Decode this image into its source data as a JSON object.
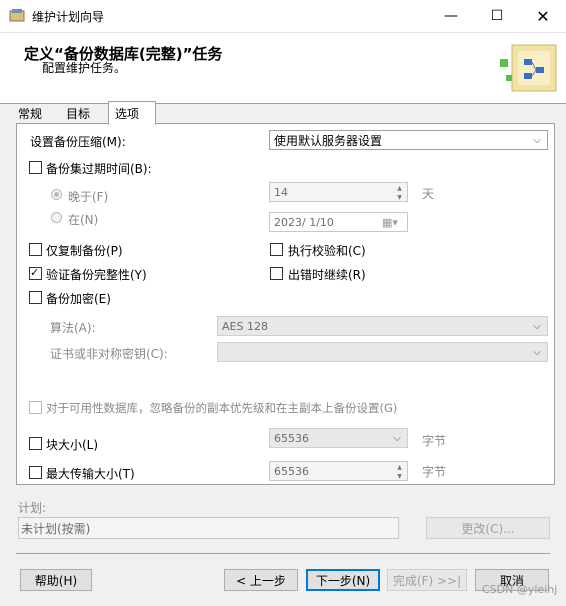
{
  "window": {
    "title": "维护计划向导"
  },
  "header": {
    "title": "定义“备份数据库(完整)”任务",
    "subtitle": "配置维护任务。"
  },
  "tabs": [
    {
      "label": "常规"
    },
    {
      "label": "目标"
    },
    {
      "label": "选项"
    }
  ],
  "options": {
    "compression_label": "设置备份压缩(M):",
    "compression_value": "使用默认服务器设置",
    "expire_label": "备份集过期时间(B):",
    "after_label": "晚于(F)",
    "after_value": "14",
    "days_unit": "天",
    "on_label": "在(N)",
    "on_value": "2023/ 1/10",
    "copy_only_label": "仅复制备份(P)",
    "checksum_label": "执行校验和(C)",
    "verify_label": "验证备份完整性(Y)",
    "continue_on_error_label": "出错时继续(R)",
    "encrypt_label": "备份加密(E)",
    "algorithm_label": "算法(A):",
    "algorithm_value": "AES 128",
    "cert_label": "证书或非对称密钥(C):",
    "cert_value": "",
    "ag_label": "对于可用性数据库，忽略备份的副本优先级和在主副本上备份设置(G)",
    "block_size_label": "块大小(L)",
    "block_size_value": "65536",
    "block_unit": "字节",
    "max_transfer_label": "最大传输大小(T)",
    "max_transfer_value": "65536",
    "transfer_unit": "字节"
  },
  "schedule": {
    "label": "计划:",
    "value": "未计划(按需)",
    "change_label": "更改(C)..."
  },
  "footer": {
    "help": "帮助(H)",
    "back": "< 上一步",
    "next": "下一步(N)",
    "finish": "完成(F) >>|",
    "cancel": "取消"
  },
  "watermark": "CSDN @yleihj"
}
